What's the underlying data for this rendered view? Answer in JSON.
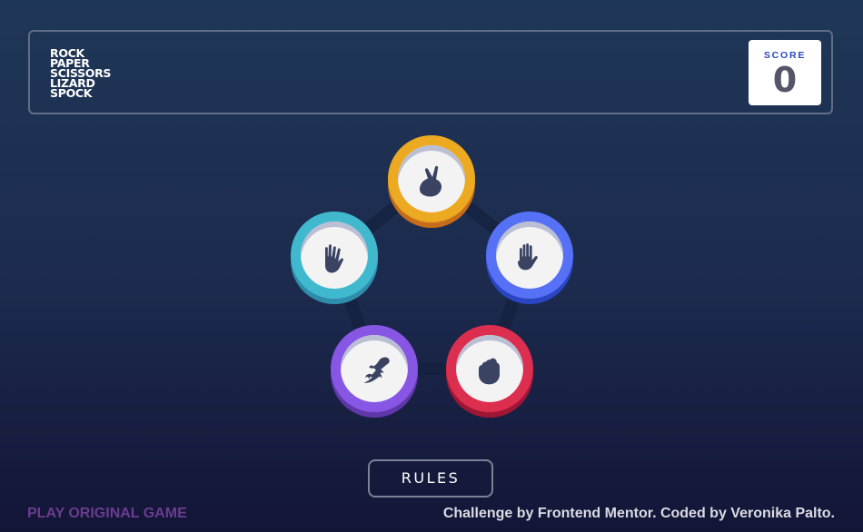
{
  "header": {
    "title_lines": [
      "ROCK",
      "PAPER",
      "SCISSORS",
      "LIZARD",
      "SPOCK"
    ],
    "score_label": "SCORE",
    "score_value": "0"
  },
  "board": {
    "chips": [
      {
        "id": "scissors",
        "color": "#eca922",
        "icon": "scissors-hand-icon"
      },
      {
        "id": "paper",
        "color": "#5671f5",
        "icon": "paper-hand-icon"
      },
      {
        "id": "rock",
        "color": "#dc2e4e",
        "icon": "rock-fist-icon"
      },
      {
        "id": "lizard",
        "color": "#8856e5",
        "icon": "lizard-icon"
      },
      {
        "id": "spock",
        "color": "#40b9ce",
        "icon": "spock-hand-icon"
      }
    ]
  },
  "footer": {
    "rules_label": "RULES",
    "play_original_label": "PLAY ORIGINAL GAME",
    "credits": "Challenge by Frontend Mentor. Coded by Veronika Palto."
  },
  "colors": {
    "background_top": "#1f3757",
    "background_bottom": "#131537",
    "icon_dark": "#3b4363"
  }
}
